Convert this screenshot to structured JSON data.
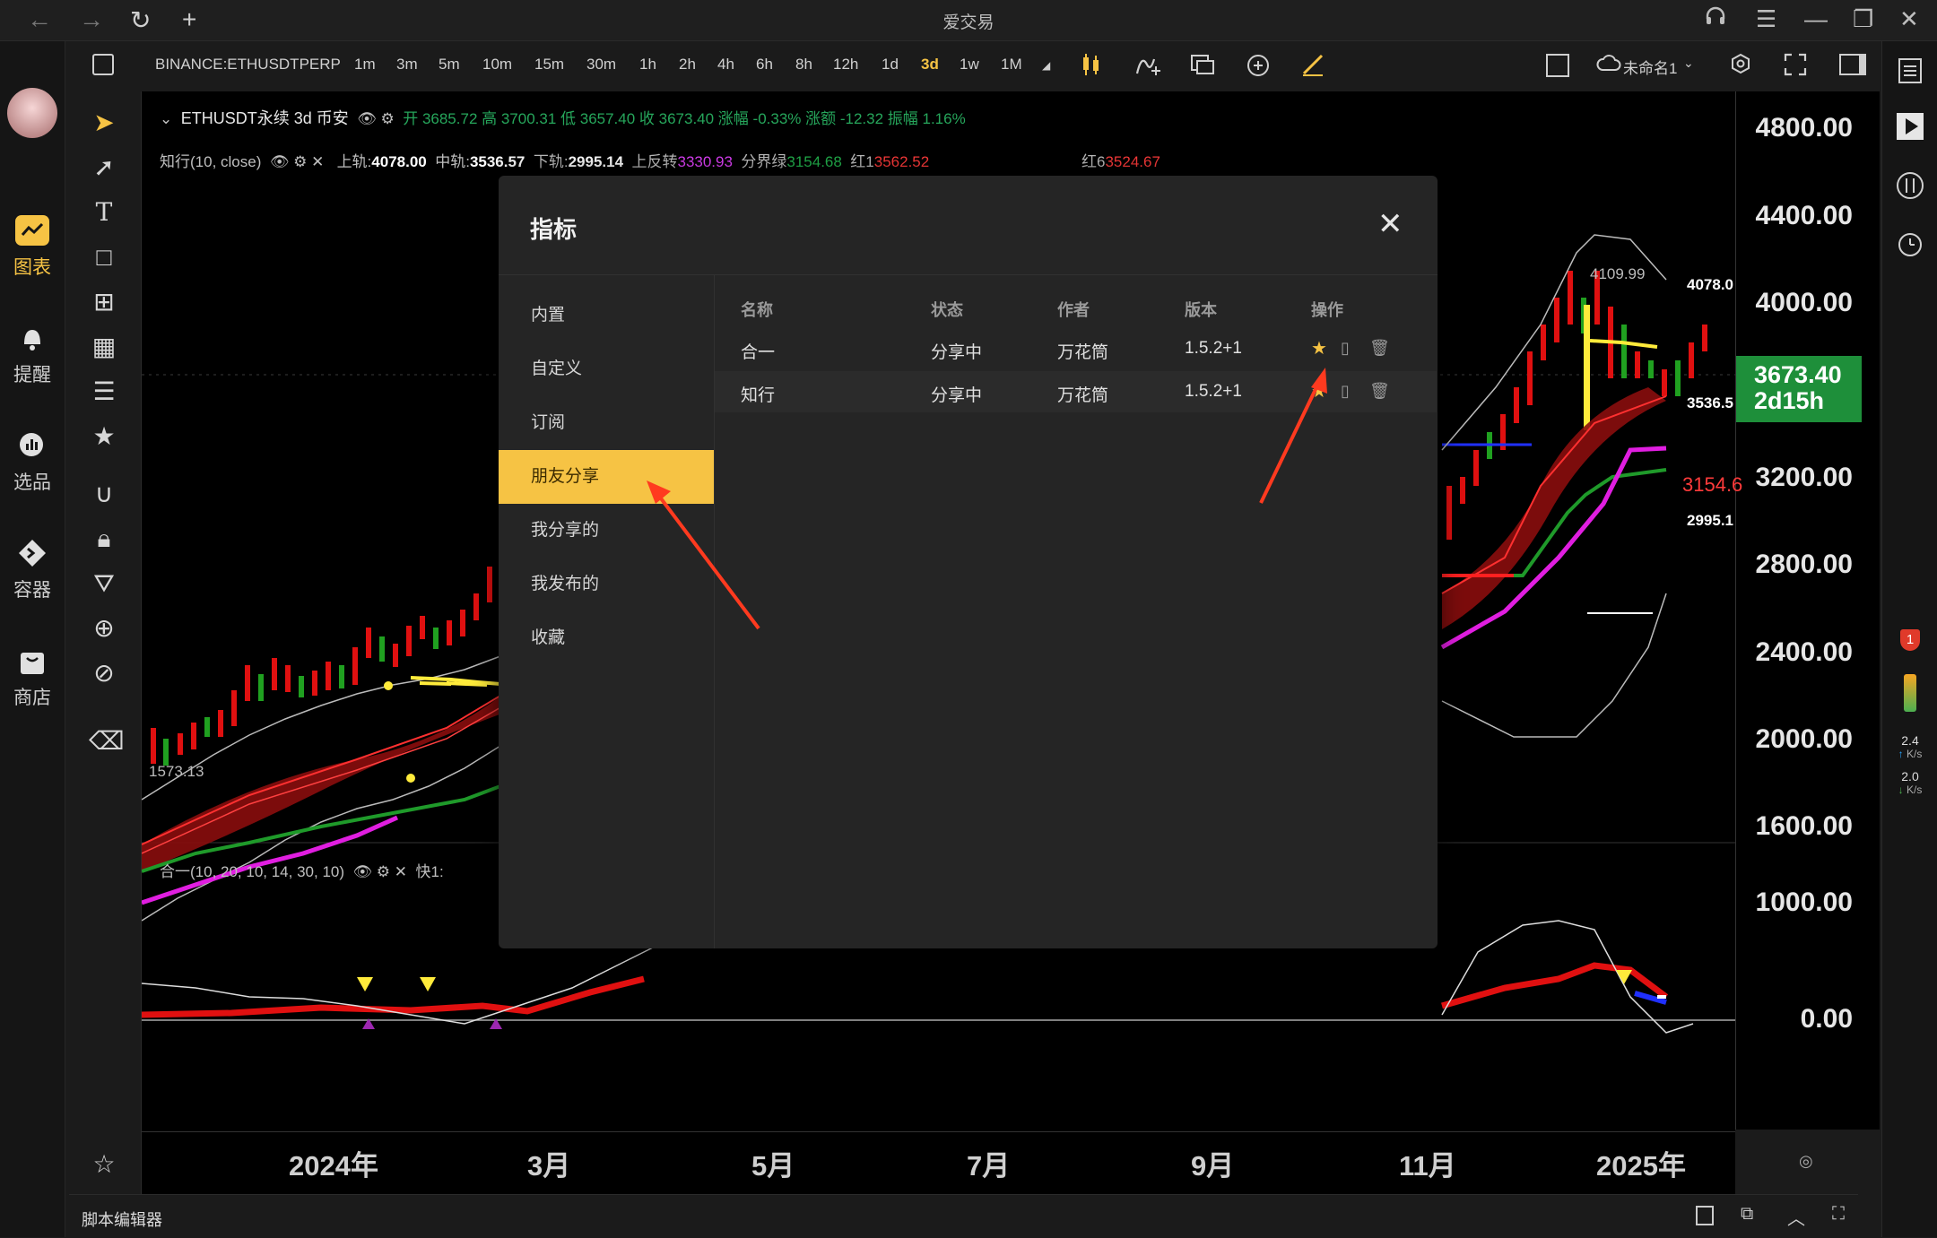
{
  "app": {
    "title": "爱交易",
    "window_controls": [
      "support-icon",
      "menu-icon",
      "minimize-icon",
      "restore-icon",
      "close-icon"
    ]
  },
  "left_nav": [
    {
      "label": "图表",
      "icon": "chart-icon",
      "active": true
    },
    {
      "label": "提醒",
      "icon": "bell-icon",
      "active": false
    },
    {
      "label": "选品",
      "icon": "scan-icon",
      "active": false
    },
    {
      "label": "容器",
      "icon": "diamond-icon",
      "active": false
    },
    {
      "label": "商店",
      "icon": "bag-icon",
      "active": false
    }
  ],
  "toolbar": {
    "symbol": "BINANCE:ETHUSDTPERP",
    "intervals": [
      "1m",
      "3m",
      "5m",
      "10m",
      "15m",
      "30m",
      "1h",
      "2h",
      "4h",
      "6h",
      "8h",
      "12h",
      "1d",
      "3d",
      "1w",
      "1M"
    ],
    "active_interval": "3d",
    "layout_name": "未命名1"
  },
  "legend": {
    "symbol_line": "ETHUSDT永续 3d 币安",
    "ohlc": "开 3685.72 高 3700.31 低 3657.40 收 3673.40 涨幅 -0.33% 涨额 -12.32 振幅 1.16%",
    "indicator_name": "知行(10, close)",
    "values": [
      {
        "label": "上轨:",
        "value": "4078.00",
        "color": "#ffffff"
      },
      {
        "label": "中轨:",
        "value": "3536.57",
        "color": "#ffffff"
      },
      {
        "label": "下轨:",
        "value": "2995.14",
        "color": "#ffffff"
      },
      {
        "label": "上反转",
        "value": "3330.93",
        "color": "#e040fb"
      },
      {
        "label": "分界绿",
        "value": "3154.68",
        "color": "#22b14c"
      },
      {
        "label": "红1",
        "value": "3562.52",
        "color": "#ff3b3b"
      },
      {
        "label": "红6",
        "value": "3524.67",
        "color": "#ff3b3b"
      }
    ],
    "osc_name": "合一(10, 20, 10, 14, 30, 10)",
    "osc_value_label": "快1:"
  },
  "price_axis": {
    "ticks": [
      "4800.00",
      "4400.00",
      "4000.00",
      "3200.00",
      "2800.00",
      "2400.00",
      "2000.00",
      "1600.00"
    ],
    "current_price": "3673.40",
    "countdown": "2d15h",
    "labels": [
      {
        "text": "4078.0",
        "color": "#ffffff"
      },
      {
        "text": "3536.5",
        "color": "#ffffff"
      },
      {
        "text": "3154.6",
        "color": "#ff3b3b"
      },
      {
        "text": "2995.1",
        "color": "#ffffff"
      }
    ],
    "high_marker": "4109.99",
    "low_marker": "1573.13"
  },
  "osc_axis": {
    "ticks": [
      "1000.00",
      "0.00"
    ]
  },
  "time_axis": {
    "ticks": [
      "2024年",
      "3月",
      "5月",
      "7月",
      "9月",
      "11月",
      "2025年"
    ]
  },
  "modal": {
    "title": "指标",
    "categories": [
      "内置",
      "自定义",
      "订阅",
      "朋友分享",
      "我分享的",
      "我发布的",
      "收藏"
    ],
    "active_category": "朋友分享",
    "columns": [
      "名称",
      "状态",
      "作者",
      "版本",
      "操作"
    ],
    "rows": [
      {
        "name": "合一",
        "status": "分享中",
        "author": "万花筒",
        "version": "1.5.2+1"
      },
      {
        "name": "知行",
        "status": "分享中",
        "author": "万花筒",
        "version": "1.5.2+1"
      }
    ]
  },
  "right_bar": {
    "speed_up": "2.4",
    "speed_down": "2.0",
    "speed_unit": "K/s",
    "badge": "1"
  },
  "bottom_bar": {
    "label": "脚本编辑器"
  }
}
